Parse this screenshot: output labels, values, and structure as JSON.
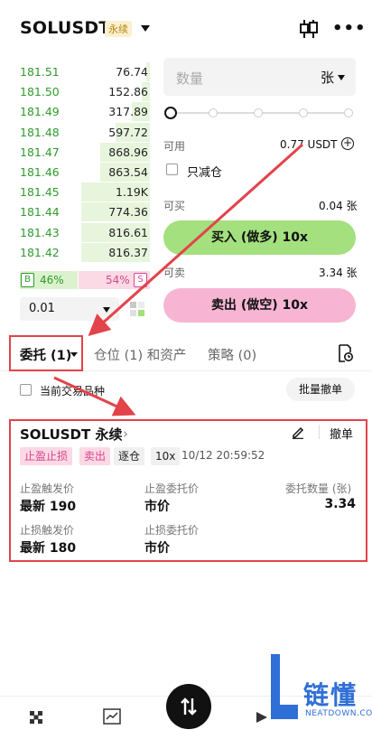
{
  "header": {
    "pair": "SOLUSDT",
    "badge": "永续"
  },
  "orderbook": {
    "rows": [
      {
        "price": "181.51",
        "qty": "76.74",
        "depth": 0.05
      },
      {
        "price": "181.50",
        "qty": "152.86",
        "depth": 0.12
      },
      {
        "price": "181.49",
        "qty": "317.89",
        "depth": 0.26
      },
      {
        "price": "181.48",
        "qty": "597.72",
        "depth": 0.5
      },
      {
        "price": "181.47",
        "qty": "868.96",
        "depth": 0.73
      },
      {
        "price": "181.46",
        "qty": "863.54",
        "depth": 0.73
      },
      {
        "price": "181.45",
        "qty": "1.19K",
        "depth": 1.0
      },
      {
        "price": "181.44",
        "qty": "774.36",
        "depth": 1.0
      },
      {
        "price": "181.43",
        "qty": "816.61",
        "depth": 1.0
      },
      {
        "price": "181.42",
        "qty": "816.37",
        "depth": 1.0
      }
    ],
    "buy_label": "B",
    "buy_pct": "46%",
    "sell_pct": "54%",
    "sell_label": "S",
    "precision": "0.01"
  },
  "form": {
    "qty_placeholder": "数量",
    "qty_unit": "张",
    "available_label": "可用",
    "available_value": "0.77 USDT",
    "reduce_only_label": "只减仓",
    "can_buy_label": "可买",
    "can_buy_value": "0.04 张",
    "buy_button": "买入 (做多) 10x",
    "can_sell_label": "可卖",
    "can_sell_value": "3.34 张",
    "sell_button": "卖出 (做空) 10x"
  },
  "tabs": {
    "orders": "委托 (1)",
    "positions": "仓位 (1) 和资产",
    "strategy": "策略 (0)"
  },
  "filters": {
    "current_only_label": "当前交易品种",
    "cancel_all": "批量撤单"
  },
  "order": {
    "title": "SOLUSDT 永续",
    "cancel": "撤单",
    "tags": [
      "止盈止损",
      "卖出",
      "逐仓",
      "10x"
    ],
    "time": "10/12 20:59:52",
    "tp_trigger_label": "止盈触发价",
    "tp_trigger_value": "最新 190",
    "tp_order_label": "止盈委托价",
    "tp_order_value": "市价",
    "qty_label": "委托数量 (张)",
    "qty_value": "3.34",
    "sl_trigger_label": "止损触发价",
    "sl_trigger_value": "最新 180",
    "sl_order_label": "止损委托价",
    "sl_order_value": "市价"
  },
  "watermark": {
    "brand": "链懂",
    "site": "NEATDOWN.COM"
  },
  "colors": {
    "buy_green": "#2e9c2b",
    "buy_button": "#a4e07e",
    "sell_pink": "#f7b5d3",
    "highlight_red": "#e3434b"
  }
}
